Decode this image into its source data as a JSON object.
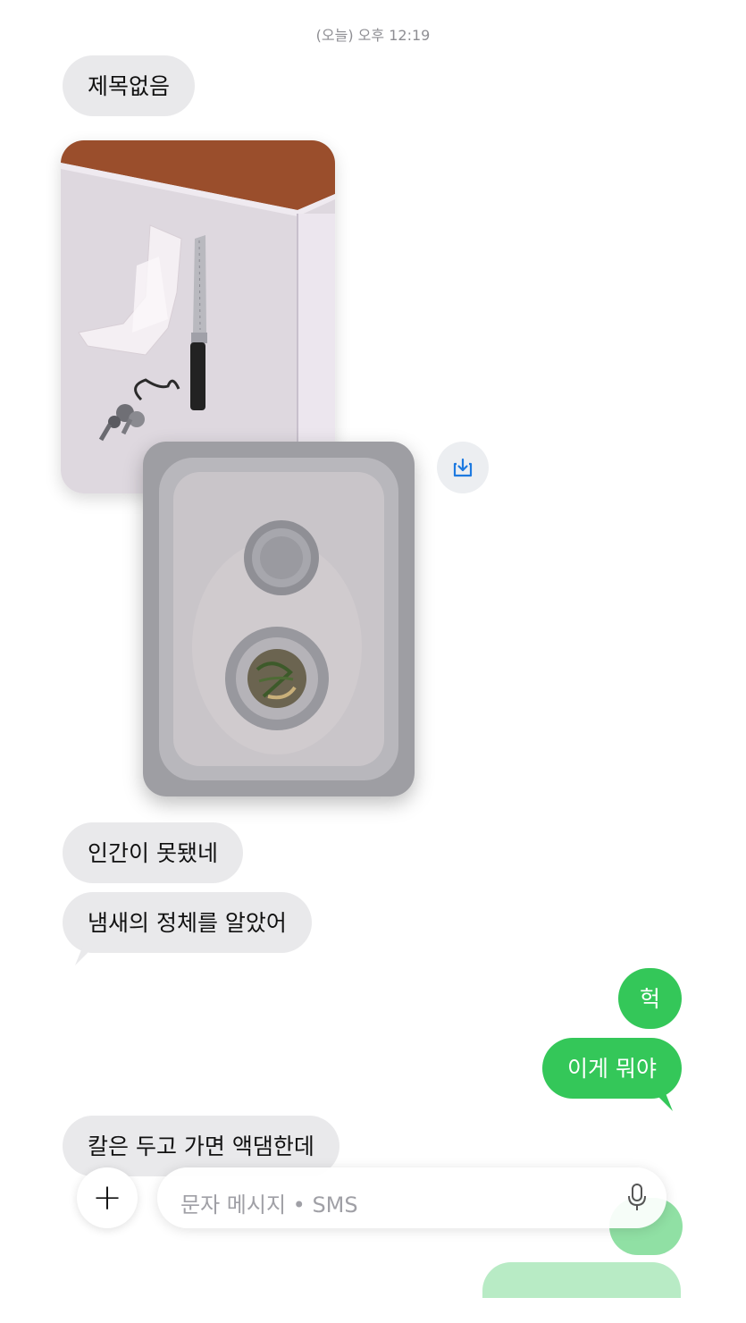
{
  "header": {
    "timestamp": "(오늘) 오후 12:19"
  },
  "messages": {
    "subject": "제목없음",
    "m1": "인간이 못됐네",
    "m2": "냄새의 정체를 알았어",
    "m3": "헉",
    "m4": "이게 뭐야",
    "m5": "칼은 두고 가면 액댐한데"
  },
  "composer": {
    "placeholder": "문자 메시지 • SMS",
    "plus": "+"
  },
  "icons": {
    "save": "save-to-device-icon",
    "mic": "microphone-icon"
  },
  "colors": {
    "incoming": "#e9e9eb",
    "outgoing": "#34c759",
    "icon_blue": "#1e7ae0"
  }
}
